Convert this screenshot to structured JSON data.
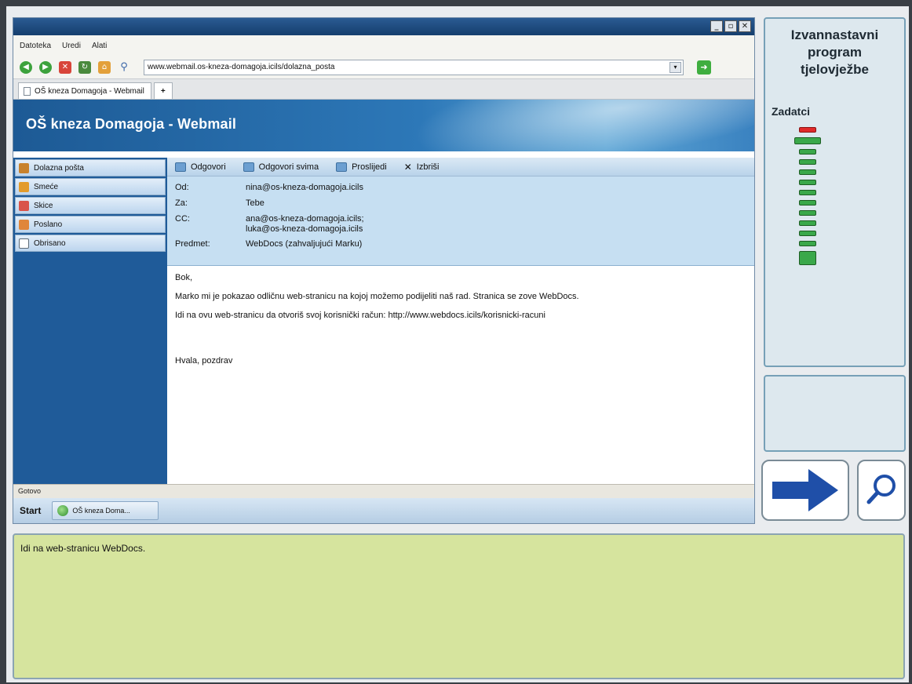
{
  "browser": {
    "window_buttons": [
      "_",
      "▫",
      "✕"
    ],
    "menu": [
      "Datoteka",
      "Uredi",
      "Alati"
    ],
    "address": "www.webmail.os-kneza-domagoja.icils/dolazna_posta",
    "tab_label": "OŠ kneza Domagoja - Webmail",
    "new_tab": "+",
    "status": "Gotovo"
  },
  "webmail": {
    "title": "OŠ kneza Domagoja - Webmail",
    "folders": [
      {
        "label": "Dolazna pošta",
        "icon_color": "#c8822d"
      },
      {
        "label": "Smeće",
        "icon_color": "#e39b2b"
      },
      {
        "label": "Skice",
        "icon_color": "#d9534a"
      },
      {
        "label": "Poslano",
        "icon_color": "#e0863a"
      },
      {
        "label": "Obrisano",
        "icon_color": "#5d6b78"
      }
    ],
    "toolbar": {
      "reply": "Odgovori",
      "reply_all": "Odgovori svima",
      "forward": "Proslijedi",
      "delete": "Izbriši"
    },
    "message": {
      "from_label": "Od:",
      "from": "nina@os-kneza-domagoja.icils",
      "to_label": "Za:",
      "to": "Tebe",
      "cc_label": "CC:",
      "cc1": "ana@os-kneza-domagoja.icils;",
      "cc2": "luka@os-kneza-domagoja.icils",
      "subject_label": "Predmet:",
      "subject": "WebDocs (zahvaljujući Marku)",
      "greeting": "Bok,",
      "line1": "Marko mi je pokazao odličnu web-stranicu na kojoj možemo podijeliti naš rad. Stranica se zove WebDocs.",
      "line2": "Idi na ovu web-stranicu da otvoriš svoj korisnički račun: http://www.webdocs.icils/korisnicki-racuni",
      "closing": "Hvala, pozdrav"
    }
  },
  "taskbar": {
    "start": "Start",
    "task": "OŠ kneza Doma..."
  },
  "side_panel": {
    "title_line1": "Izvannastavni",
    "title_line2": "program",
    "title_line3": "tjelovježbe",
    "tasks_heading": "Zadatci",
    "task_states": [
      "current",
      "done",
      "pending",
      "pending",
      "pending",
      "pending",
      "pending",
      "pending",
      "pending",
      "pending",
      "pending",
      "pending",
      "last"
    ],
    "colors": {
      "current": "#e02a2a",
      "pending": "#3aa84a",
      "panel_border": "#76a0b7"
    }
  },
  "instruction": "Idi na web-stranicu WebDocs."
}
